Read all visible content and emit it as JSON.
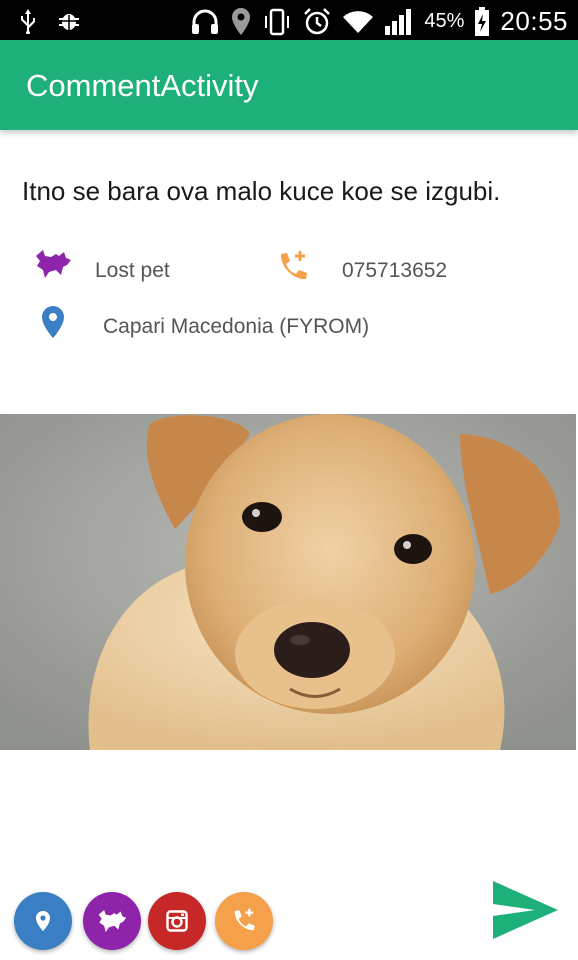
{
  "status_bar": {
    "battery_percent": "45%",
    "time": "20:55",
    "icons": [
      "usb-icon",
      "android-debug-icon",
      "headset-icon",
      "location-icon",
      "vibrate-icon",
      "alarm-icon",
      "wifi-icon",
      "signal-icon",
      "battery-charging-icon"
    ]
  },
  "app_bar": {
    "title": "CommentActivity",
    "color": "#1eb079"
  },
  "post": {
    "text": "Itno se bara ova malo kuce koe se izgubi.",
    "category": "Lost pet",
    "phone": "075713652",
    "location": "Capari Macedonia (FYROM)"
  },
  "colors": {
    "category_icon": "#8e24aa",
    "phone_icon": "#f5a04a",
    "location_icon": "#3a7fc4",
    "fab_location": "#3a7fc4",
    "fab_pet": "#8e24aa",
    "fab_instagram": "#c62828",
    "fab_phone": "#f5a04a",
    "send_icon": "#1eb079"
  },
  "image": {
    "subject": "puppy photo"
  },
  "bottom_actions": [
    "location-fab",
    "pet-fab",
    "instagram-fab",
    "phone-fab",
    "send-button"
  ]
}
